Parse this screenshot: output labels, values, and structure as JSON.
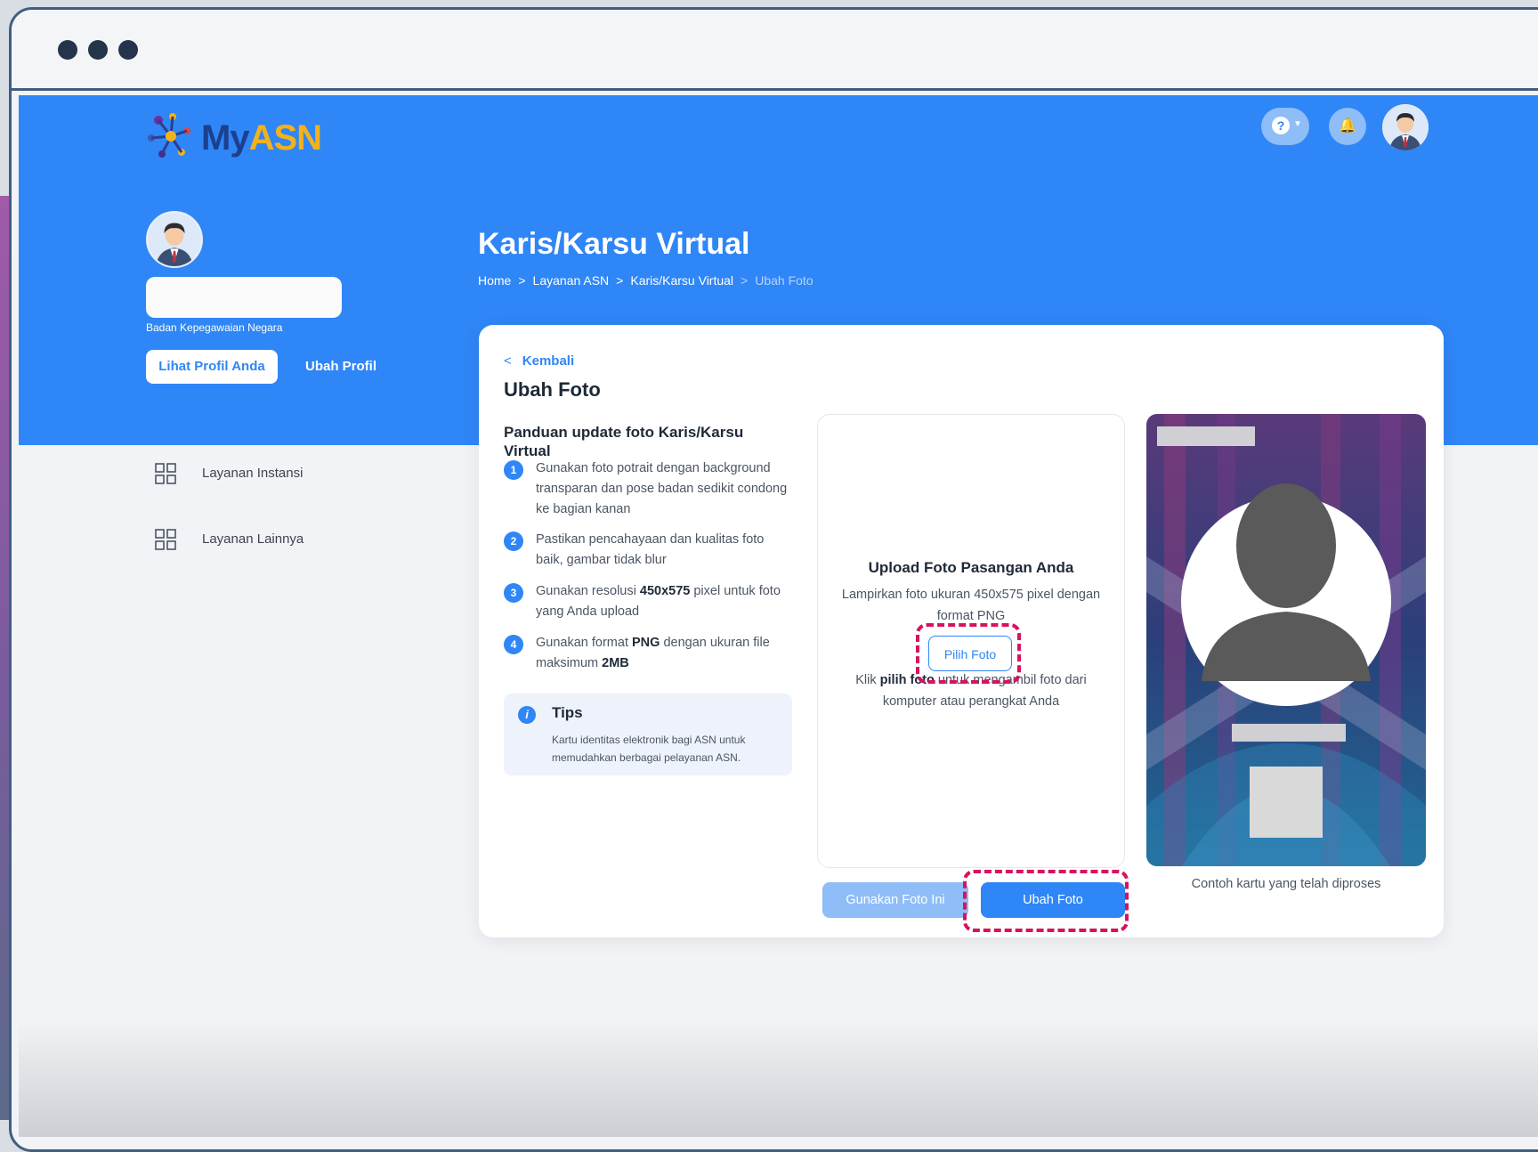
{
  "window": {
    "dots": 3
  },
  "app": {
    "logo_my": "My",
    "logo_asn": "ASN"
  },
  "profile": {
    "institution": "Badan Kepegawaian Negara",
    "view_profile_label": "Lihat Profil Anda",
    "edit_profile_label": "Ubah Profil"
  },
  "sidebar": {
    "items": [
      {
        "label": "Layanan Instansi",
        "icon": "grid-icon"
      },
      {
        "label": "Layanan Lainnya",
        "icon": "grid-icon"
      }
    ]
  },
  "header": {
    "page_title": "Karis/Karsu Virtual",
    "breadcrumb": [
      "Home",
      "Layanan ASN",
      "Karis/Karsu Virtual",
      "Ubah Foto"
    ],
    "breadcrumb_sep": ">"
  },
  "card": {
    "back_label": "Kembali",
    "title": "Ubah Foto",
    "guide_title": "Panduan update foto Karis/Karsu Virtual",
    "steps": [
      {
        "num": "1",
        "text": "Gunakan foto potrait dengan background transparan dan pose badan sedikit condong ke bagian kanan"
      },
      {
        "num": "2",
        "text": "Pastikan pencahayaan dan kualitas foto baik, gambar tidak blur"
      },
      {
        "num": "3",
        "pre": "Gunakan resolusi ",
        "bold": "450x575",
        "post": " pixel untuk foto yang Anda upload"
      },
      {
        "num": "4",
        "pre": "Gunakan format ",
        "bold": "PNG",
        "mid": " dengan ukuran file maksimum ",
        "bold2": "2MB"
      }
    ],
    "tips": {
      "title": "Tips",
      "text": "Kartu identitas elektronik bagi ASN untuk memudahkan berbagai pelayanan ASN."
    },
    "upload": {
      "title": "Upload Foto Pasangan Anda",
      "desc": "Lampirkan foto ukuran 450x575 pixel dengan format PNG",
      "pick_label": "Pilih Foto",
      "hint_pre": "Klik ",
      "hint_bold": "pilih foto",
      "hint_post": " untuk mengambil foto dari komputer atau perangkat Anda"
    },
    "use_photo_label": "Gunakan Foto Ini",
    "change_photo_label": "Ubah Foto",
    "sample_caption": "Contoh kartu yang telah diproses"
  },
  "colors": {
    "primary": "#2f86f6",
    "highlight": "#d6135f",
    "frame": "#3f5f80"
  }
}
